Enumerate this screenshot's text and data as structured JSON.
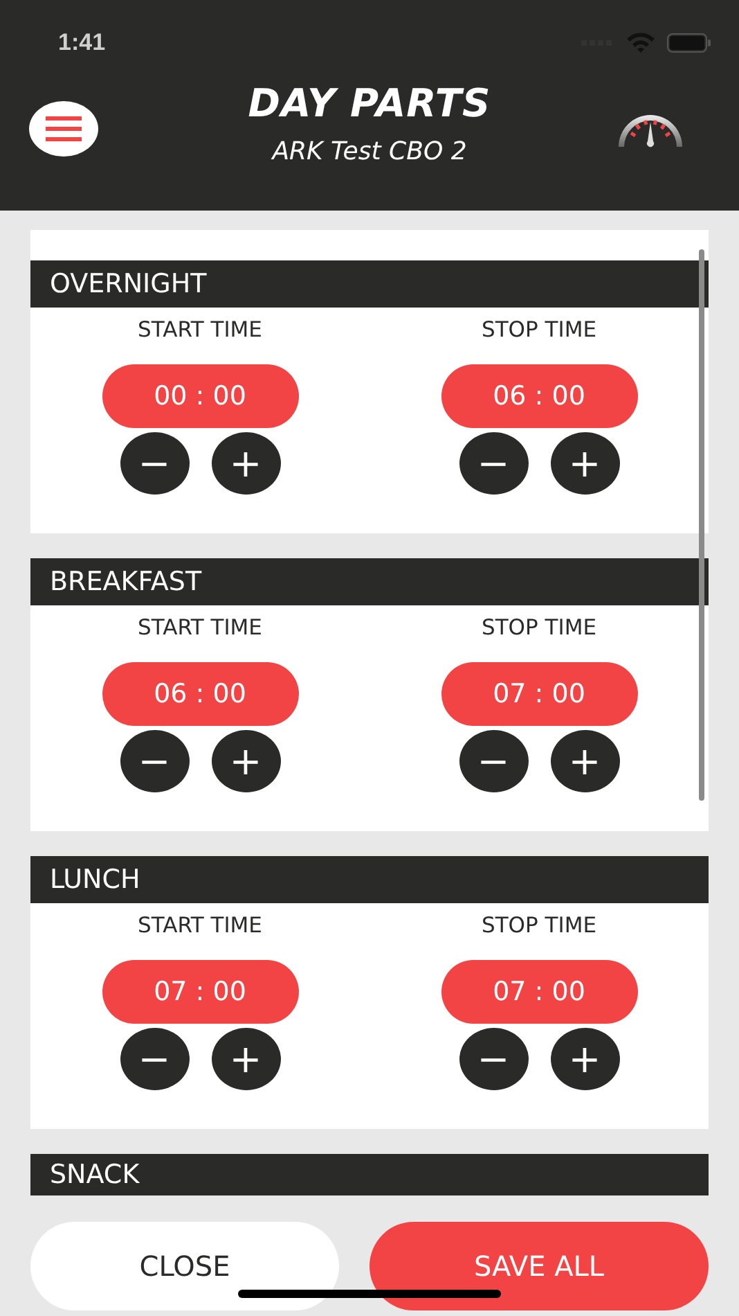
{
  "status_bar": {
    "time": "1:41"
  },
  "header": {
    "title": "DAY PARTS",
    "subtitle": "ARK Test CBO 2"
  },
  "day_parts": [
    {
      "name": "OVERNIGHT",
      "start_label": "START TIME",
      "start": "00 : 00",
      "stop_label": "STOP TIME",
      "stop": "06 : 00",
      "minus": "−",
      "plus": "+"
    },
    {
      "name": "BREAKFAST",
      "start_label": "START TIME",
      "start": "06 : 00",
      "stop_label": "STOP TIME",
      "stop": "07 : 00",
      "minus": "−",
      "plus": "+"
    },
    {
      "name": "LUNCH",
      "start_label": "START TIME",
      "start": "07 : 00",
      "stop_label": "STOP TIME",
      "stop": "07 : 00",
      "minus": "−",
      "plus": "+"
    },
    {
      "name": "SNACK"
    }
  ],
  "buttons": {
    "close": "CLOSE",
    "save": "SAVE ALL"
  }
}
